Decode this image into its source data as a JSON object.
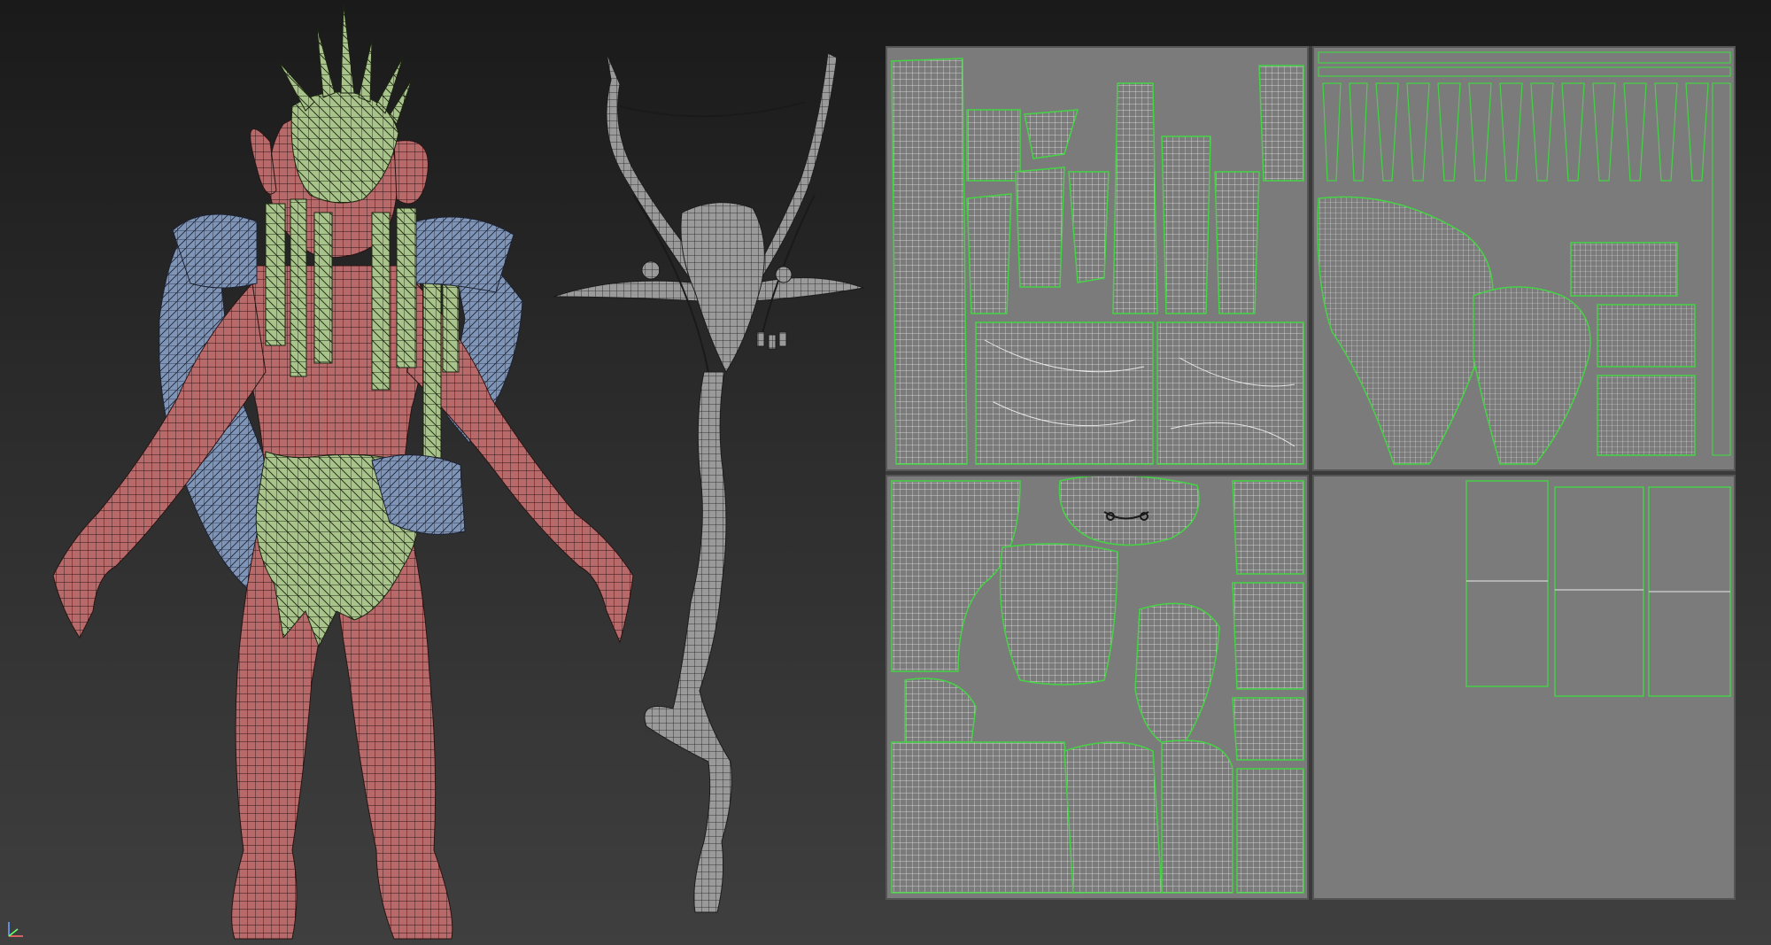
{
  "viewport": {
    "background_top": "#1a1a1a",
    "background_bottom": "#3f3f3f"
  },
  "scene": {
    "character_skin_color": "#b86a6a",
    "character_cloth_color": "#a9c48a",
    "character_feather_color": "#7f95b8",
    "staff_color": "#9a9a9a",
    "wire_color": "#1a1a1a"
  },
  "uv_editor": {
    "tile_background": "#7b7b7b",
    "island_border_color": "#44d444",
    "wire_color": "#e8e8e8",
    "tiles": [
      {
        "id": "1001",
        "style": "staff-uvs"
      },
      {
        "id": "1002",
        "style": "accessory-uvs"
      },
      {
        "id": "1003",
        "style": "body-uvs"
      },
      {
        "id": "1004",
        "style": "partial-uvs"
      }
    ]
  },
  "icons": {
    "axis_gizmo": "axis-gizmo-icon"
  }
}
